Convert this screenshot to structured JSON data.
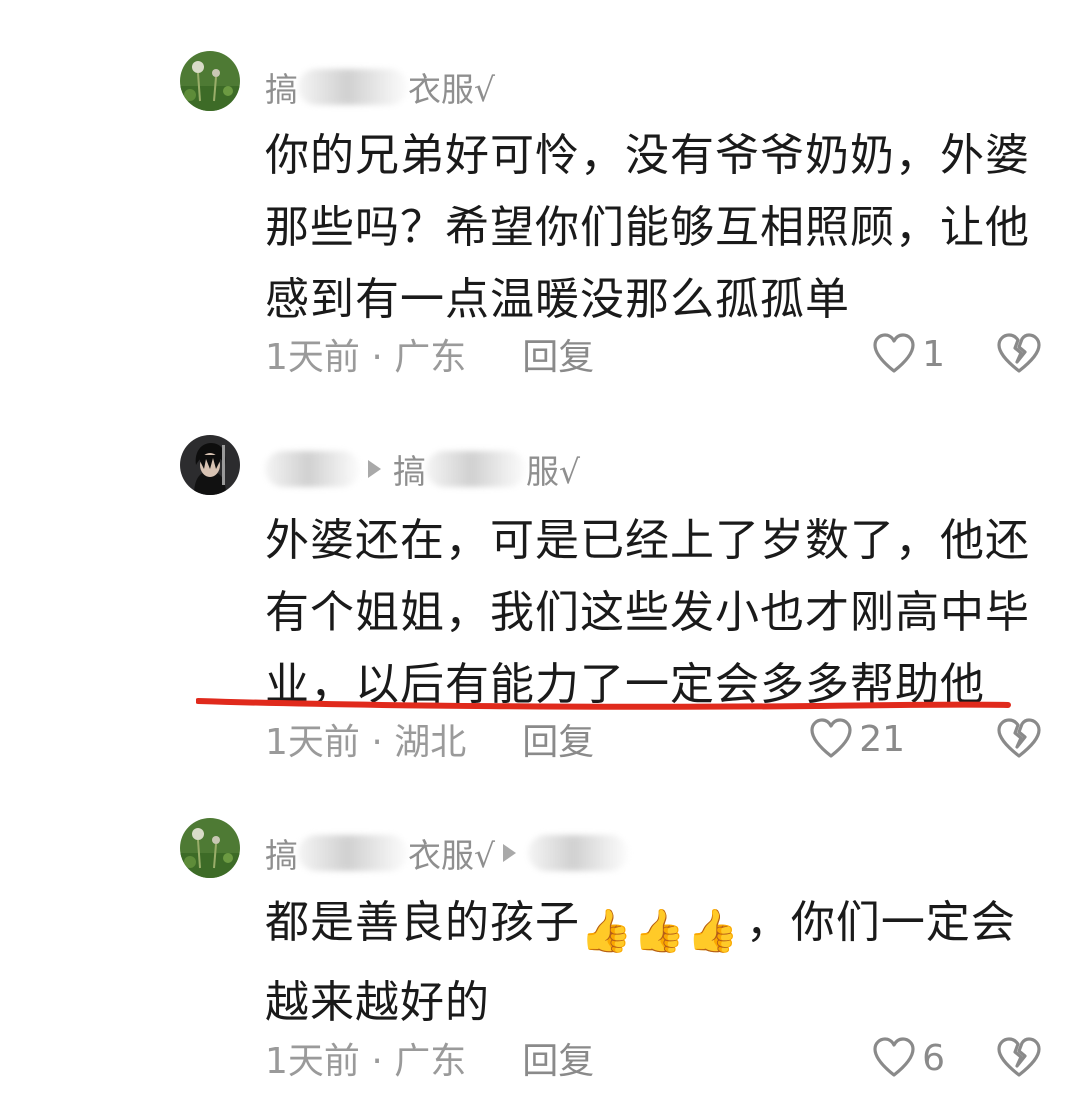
{
  "comments": [
    {
      "name_prefix": "搞",
      "name_suffix": "衣服√",
      "reply_to": "",
      "body": "你的兄弟好可怜，没有爷爷奶奶，外婆那些吗？希望你们能够互相照顾，让他感到有一点温暖没那么孤孤单",
      "time_location": "1天前 · 广东",
      "reply_label": "回复",
      "likes": "1",
      "avatar_icon": "plant-photo-avatar"
    },
    {
      "name_prefix": "",
      "name_suffix": "",
      "reply_to_prefix": "搞",
      "reply_to_suffix": "服√",
      "body": "外婆还在，可是已经上了岁数了，他还有个姐姐，我们这些发小也才刚高中毕业，以后有能力了一定会多多帮助他",
      "time_location": "1天前 · 湖北",
      "reply_label": "回复",
      "likes": "21",
      "avatar_icon": "anime-character-avatar"
    },
    {
      "name_prefix": "搞",
      "name_suffix": "衣服√",
      "reply_to": "",
      "body_before_emoji": "都是善良的孩子",
      "body_after_emoji": "，你们一定会越来越好的",
      "emoji": "👍👍👍",
      "time_location": "1天前 · 广东",
      "reply_label": "回复",
      "likes": "6",
      "avatar_icon": "plant-photo-avatar"
    }
  ],
  "colors": {
    "text": "#1a1a1a",
    "meta": "#9a9a9a",
    "underline": "#e02a1c",
    "icon": "#8a8a8a"
  }
}
